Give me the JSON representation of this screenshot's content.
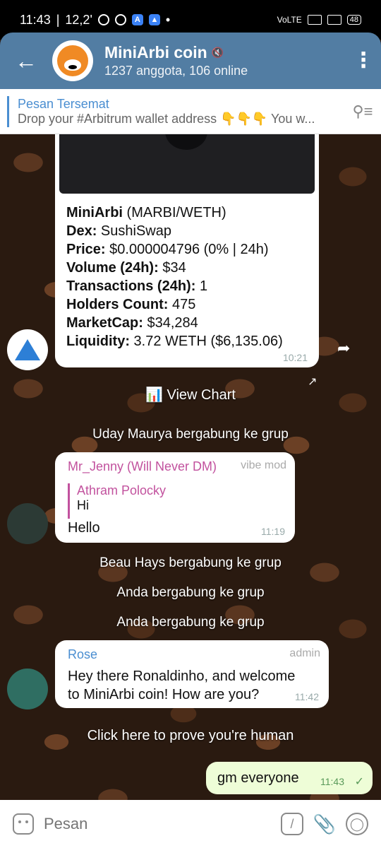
{
  "status_bar": {
    "time": "11:43",
    "speed": "12,2'",
    "battery": "48"
  },
  "header": {
    "title": "MiniArbi coin",
    "subtitle": "1237 anggota, 106 online"
  },
  "pinned": {
    "title": "Pesan Tersemat",
    "message": "Drop your #Arbitrum wallet address 👇👇👇  You w..."
  },
  "card": {
    "line1_name": "MiniArbi",
    "line1_rest": " (MARBI/WETH)",
    "dex_label": "Dex:",
    "dex_value": " SushiSwap",
    "price_label": "Price:",
    "price_value": " $0.000004796 (0% | 24h)",
    "volume_label": "Volume (24h):",
    "volume_value": " $34",
    "tx_label": "Transactions (24h):",
    "tx_value": " 1",
    "holders_label": "Holders Count:",
    "holders_value": " 475",
    "mcap_label": "MarketCap:",
    "mcap_value": " $34,284",
    "liq_label": "Liquidity:",
    "liq_value": " 3.72 WETH ($6,135.06)",
    "time": "10:21"
  },
  "view_chart": "📊 View Chart",
  "system_messages": [
    "Uday Maurya bergabung ke grup",
    "Beau Hays bergabung ke grup",
    "Anda bergabung ke grup",
    "Anda bergabung ke grup"
  ],
  "jenny": {
    "sender": "Mr_Jenny (Will Never DM)",
    "role": "vibe mod",
    "quote_name": "Athram Polocky",
    "quote_text": "Hi",
    "text": "Hello",
    "time": "11:19"
  },
  "rose": {
    "sender": "Rose",
    "role": "admin",
    "text_line1": "Hey there Ronaldinho, and welcome",
    "text_line2": "to MiniArbi coin! How are you?",
    "time": "11:42"
  },
  "prove_human": "Click here to prove you're human",
  "outgoing": {
    "text": "gm everyone",
    "time": "11:43"
  },
  "composer": {
    "placeholder": "Pesan"
  },
  "colors": {
    "header": "#527da3",
    "accent": "#4a8ed1",
    "jenny": "#c2529e",
    "rose": "#4a8ed1"
  }
}
